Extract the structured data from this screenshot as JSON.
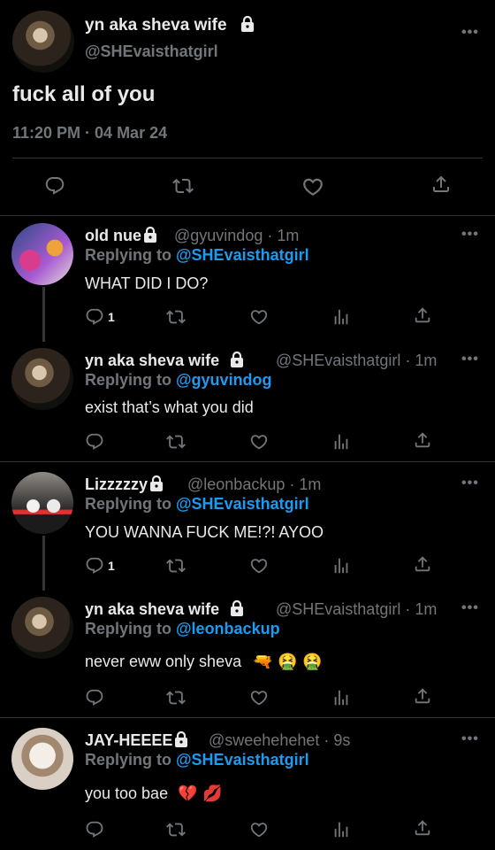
{
  "main_tweet": {
    "name": "yn aka sheva wife",
    "handle": "@SHEvaisthatgirl",
    "text": "fuck all of you",
    "timestamp": "11:20 PM · 04 Mar 24",
    "more": "•••"
  },
  "replies": [
    {
      "name": "old nue",
      "handle": "@gyuvindog · 1m",
      "replying_prefix": "Replying to ",
      "replying_to": "@SHEvaisthatgirl",
      "text": "WHAT DID I DO?",
      "reply_count": "1",
      "more": "•••"
    },
    {
      "name": "yn aka sheva wife",
      "handle": "@SHEvaisthatgirl · 1m",
      "replying_prefix": "Replying to ",
      "replying_to": "@gyuvindog",
      "text": "exist that’s what you did",
      "reply_count": "",
      "more": "•••"
    },
    {
      "name": "Lizzzzzy",
      "handle": "@leonbackup · 1m",
      "replying_prefix": "Replying to ",
      "replying_to": "@SHEvaisthatgirl",
      "text": "YOU WANNA FUCK ME!?! AYOO",
      "reply_count": "1",
      "more": "•••"
    },
    {
      "name": "yn aka sheva wife",
      "handle": "@SHEvaisthatgirl · 1m",
      "replying_prefix": "Replying to ",
      "replying_to": "@leonbackup",
      "text": "never eww only sheva",
      "emojis": "🔫 🤮 🤮",
      "reply_count": "",
      "more": "•••"
    },
    {
      "name": "JAY-HEEEE",
      "handle": "@sweehehehet · 9s",
      "replying_prefix": "Replying to ",
      "replying_to": "@SHEvaisthatgirl",
      "text": "you too bae",
      "emojis": "💔 💋",
      "reply_count": "",
      "more": "•••"
    }
  ],
  "colors": {
    "background": "#000000",
    "text": "#e7e9ea",
    "muted": "#71767b",
    "accent": "#1d9bf0",
    "divider": "#2f3336"
  },
  "icons": [
    "reply-icon",
    "retweet-icon",
    "like-icon",
    "views-icon",
    "share-icon",
    "lock-icon"
  ]
}
